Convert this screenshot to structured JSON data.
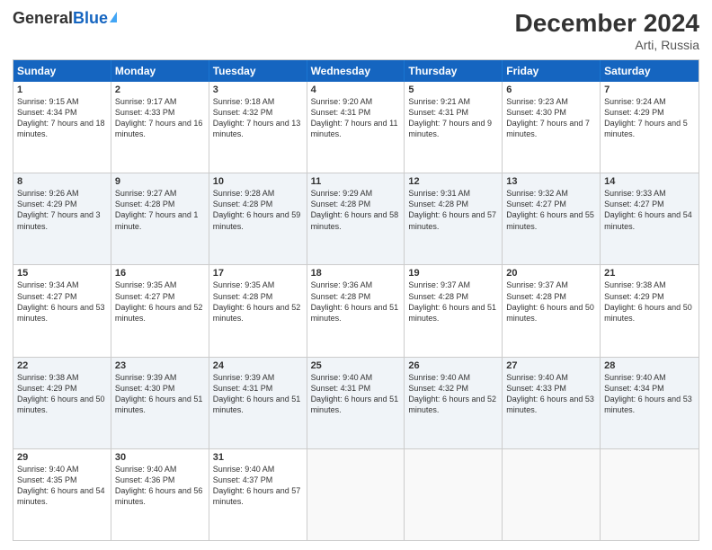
{
  "header": {
    "logo_general": "General",
    "logo_blue": "Blue",
    "month_title": "December 2024",
    "location": "Arti, Russia"
  },
  "days_of_week": [
    "Sunday",
    "Monday",
    "Tuesday",
    "Wednesday",
    "Thursday",
    "Friday",
    "Saturday"
  ],
  "rows": [
    {
      "alt": false,
      "cells": [
        {
          "day": "1",
          "sunrise": "9:15 AM",
          "sunset": "4:34 PM",
          "daylight": "7 hours and 18 minutes."
        },
        {
          "day": "2",
          "sunrise": "9:17 AM",
          "sunset": "4:33 PM",
          "daylight": "7 hours and 16 minutes."
        },
        {
          "day": "3",
          "sunrise": "9:18 AM",
          "sunset": "4:32 PM",
          "daylight": "7 hours and 13 minutes."
        },
        {
          "day": "4",
          "sunrise": "9:20 AM",
          "sunset": "4:31 PM",
          "daylight": "7 hours and 11 minutes."
        },
        {
          "day": "5",
          "sunrise": "9:21 AM",
          "sunset": "4:31 PM",
          "daylight": "7 hours and 9 minutes."
        },
        {
          "day": "6",
          "sunrise": "9:23 AM",
          "sunset": "4:30 PM",
          "daylight": "7 hours and 7 minutes."
        },
        {
          "day": "7",
          "sunrise": "9:24 AM",
          "sunset": "4:29 PM",
          "daylight": "7 hours and 5 minutes."
        }
      ]
    },
    {
      "alt": true,
      "cells": [
        {
          "day": "8",
          "sunrise": "9:26 AM",
          "sunset": "4:29 PM",
          "daylight": "7 hours and 3 minutes."
        },
        {
          "day": "9",
          "sunrise": "9:27 AM",
          "sunset": "4:28 PM",
          "daylight": "7 hours and 1 minute."
        },
        {
          "day": "10",
          "sunrise": "9:28 AM",
          "sunset": "4:28 PM",
          "daylight": "6 hours and 59 minutes."
        },
        {
          "day": "11",
          "sunrise": "9:29 AM",
          "sunset": "4:28 PM",
          "daylight": "6 hours and 58 minutes."
        },
        {
          "day": "12",
          "sunrise": "9:31 AM",
          "sunset": "4:28 PM",
          "daylight": "6 hours and 57 minutes."
        },
        {
          "day": "13",
          "sunrise": "9:32 AM",
          "sunset": "4:27 PM",
          "daylight": "6 hours and 55 minutes."
        },
        {
          "day": "14",
          "sunrise": "9:33 AM",
          "sunset": "4:27 PM",
          "daylight": "6 hours and 54 minutes."
        }
      ]
    },
    {
      "alt": false,
      "cells": [
        {
          "day": "15",
          "sunrise": "9:34 AM",
          "sunset": "4:27 PM",
          "daylight": "6 hours and 53 minutes."
        },
        {
          "day": "16",
          "sunrise": "9:35 AM",
          "sunset": "4:27 PM",
          "daylight": "6 hours and 52 minutes."
        },
        {
          "day": "17",
          "sunrise": "9:35 AM",
          "sunset": "4:28 PM",
          "daylight": "6 hours and 52 minutes."
        },
        {
          "day": "18",
          "sunrise": "9:36 AM",
          "sunset": "4:28 PM",
          "daylight": "6 hours and 51 minutes."
        },
        {
          "day": "19",
          "sunrise": "9:37 AM",
          "sunset": "4:28 PM",
          "daylight": "6 hours and 51 minutes."
        },
        {
          "day": "20",
          "sunrise": "9:37 AM",
          "sunset": "4:28 PM",
          "daylight": "6 hours and 50 minutes."
        },
        {
          "day": "21",
          "sunrise": "9:38 AM",
          "sunset": "4:29 PM",
          "daylight": "6 hours and 50 minutes."
        }
      ]
    },
    {
      "alt": true,
      "cells": [
        {
          "day": "22",
          "sunrise": "9:38 AM",
          "sunset": "4:29 PM",
          "daylight": "6 hours and 50 minutes."
        },
        {
          "day": "23",
          "sunrise": "9:39 AM",
          "sunset": "4:30 PM",
          "daylight": "6 hours and 51 minutes."
        },
        {
          "day": "24",
          "sunrise": "9:39 AM",
          "sunset": "4:31 PM",
          "daylight": "6 hours and 51 minutes."
        },
        {
          "day": "25",
          "sunrise": "9:40 AM",
          "sunset": "4:31 PM",
          "daylight": "6 hours and 51 minutes."
        },
        {
          "day": "26",
          "sunrise": "9:40 AM",
          "sunset": "4:32 PM",
          "daylight": "6 hours and 52 minutes."
        },
        {
          "day": "27",
          "sunrise": "9:40 AM",
          "sunset": "4:33 PM",
          "daylight": "6 hours and 53 minutes."
        },
        {
          "day": "28",
          "sunrise": "9:40 AM",
          "sunset": "4:34 PM",
          "daylight": "6 hours and 53 minutes."
        }
      ]
    },
    {
      "alt": false,
      "cells": [
        {
          "day": "29",
          "sunrise": "9:40 AM",
          "sunset": "4:35 PM",
          "daylight": "6 hours and 54 minutes."
        },
        {
          "day": "30",
          "sunrise": "9:40 AM",
          "sunset": "4:36 PM",
          "daylight": "6 hours and 56 minutes."
        },
        {
          "day": "31",
          "sunrise": "9:40 AM",
          "sunset": "4:37 PM",
          "daylight": "6 hours and 57 minutes."
        },
        {
          "day": "",
          "sunrise": "",
          "sunset": "",
          "daylight": ""
        },
        {
          "day": "",
          "sunrise": "",
          "sunset": "",
          "daylight": ""
        },
        {
          "day": "",
          "sunrise": "",
          "sunset": "",
          "daylight": ""
        },
        {
          "day": "",
          "sunrise": "",
          "sunset": "",
          "daylight": ""
        }
      ]
    }
  ],
  "labels": {
    "sunrise_prefix": "Sunrise: ",
    "sunset_prefix": "Sunset: ",
    "daylight_prefix": "Daylight: "
  }
}
